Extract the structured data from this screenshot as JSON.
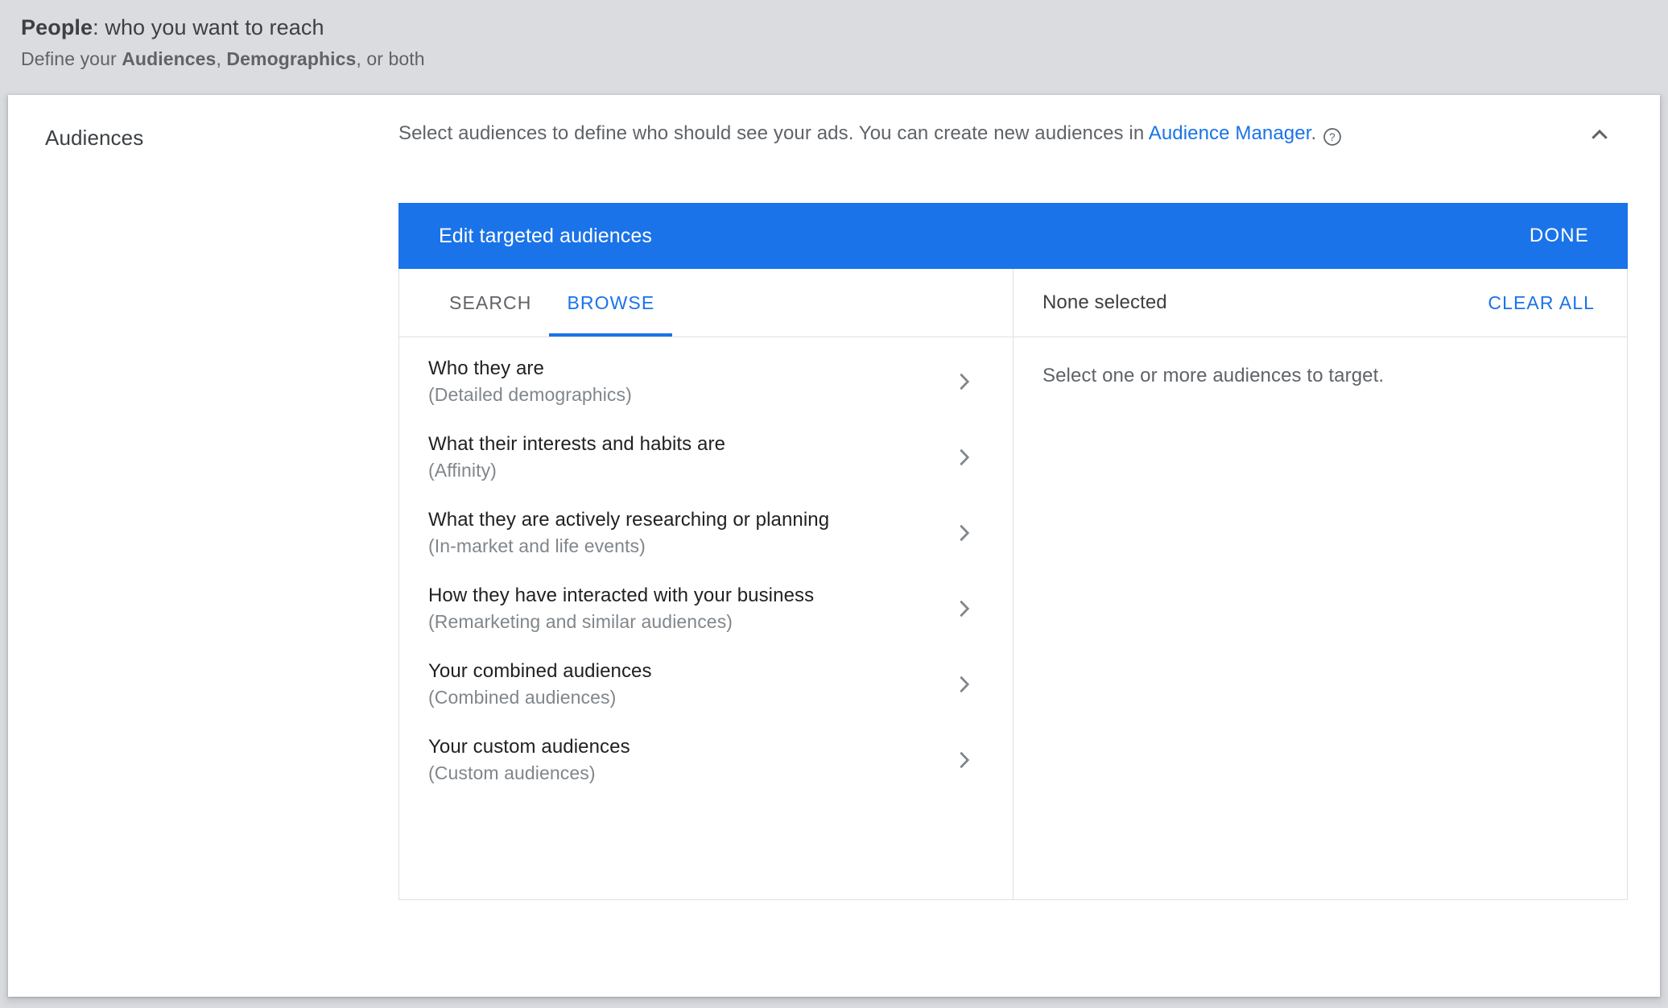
{
  "page_header": {
    "title_bold": "People",
    "title_rest": ": who you want to reach",
    "sub_prefix": "Define your ",
    "sub_bold_1": "Audiences",
    "sub_mid": ", ",
    "sub_bold_2": "Demographics",
    "sub_suffix": ", or both"
  },
  "section": {
    "label": "Audiences",
    "description_prefix": "Select audiences to define who should see your ads.  You can create new audiences in ",
    "description_link": "Audience Manager",
    "description_suffix": ".",
    "help_icon": "help-circle-icon",
    "collapse_icon": "chevron-up-icon"
  },
  "dialog": {
    "title": "Edit targeted audiences",
    "done_label": "DONE"
  },
  "tabs": [
    {
      "label": "SEARCH",
      "active": false,
      "name": "tab-search"
    },
    {
      "label": "BROWSE",
      "active": true,
      "name": "tab-browse"
    }
  ],
  "selection": {
    "status": "None selected",
    "clear_all_label": "CLEAR ALL",
    "empty_message": "Select one or more audiences to target."
  },
  "browse_items": [
    {
      "title": "Who they are",
      "subtitle": "(Detailed demographics)",
      "chevron": "chevron-right-icon"
    },
    {
      "title": "What their interests and habits are",
      "subtitle": "(Affinity)",
      "chevron": "chevron-right-icon"
    },
    {
      "title": "What they are actively researching or planning",
      "subtitle": "(In-market and life events)",
      "chevron": "chevron-right-icon"
    },
    {
      "title": "How they have interacted with your business",
      "subtitle": "(Remarketing and similar audiences)",
      "chevron": "chevron-right-icon"
    },
    {
      "title": "Your combined audiences",
      "subtitle": "(Combined audiences)",
      "chevron": "chevron-right-icon"
    },
    {
      "title": "Your custom audiences",
      "subtitle": "(Custom audiences)",
      "chevron": "chevron-right-icon"
    }
  ],
  "colors": {
    "accent_blue": "#1a73e8",
    "page_background": "#dadce0",
    "card_background": "#ffffff",
    "text_primary": "#202124",
    "text_secondary": "#5f6368",
    "text_muted": "#80868b",
    "divider": "#e0e0e0"
  }
}
